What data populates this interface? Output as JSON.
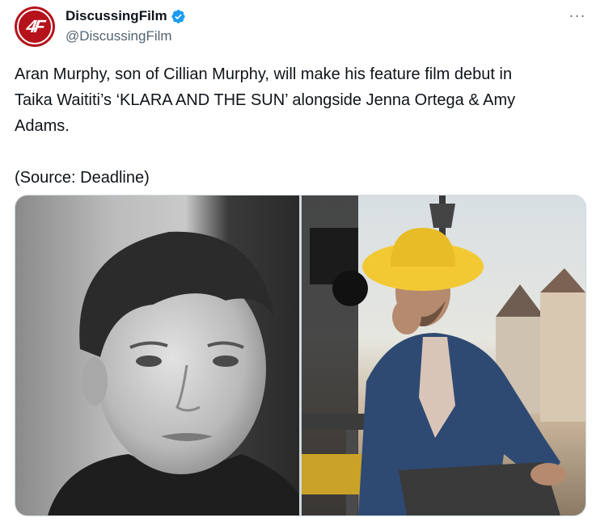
{
  "author": {
    "display_name": "DiscussingFilm",
    "handle": "@DiscussingFilm",
    "avatar_text": "4F",
    "verified": true
  },
  "tweet": {
    "text": "Aran Murphy, son of Cillian Murphy, will make his feature film debut in\nTaika Waititi’s ‘KLARA AND THE SUN’ alongside Jenna Ortega & Amy\nAdams.\n\n(Source: Deadline)"
  },
  "actions": {
    "more_label": "···"
  },
  "colors": {
    "avatar_red": "#b5121b",
    "verified_blue": "#1d9bf0",
    "secondary_text": "#536471"
  },
  "icons": {
    "verified": "verified-badge-icon",
    "more": "more-options-icon"
  }
}
